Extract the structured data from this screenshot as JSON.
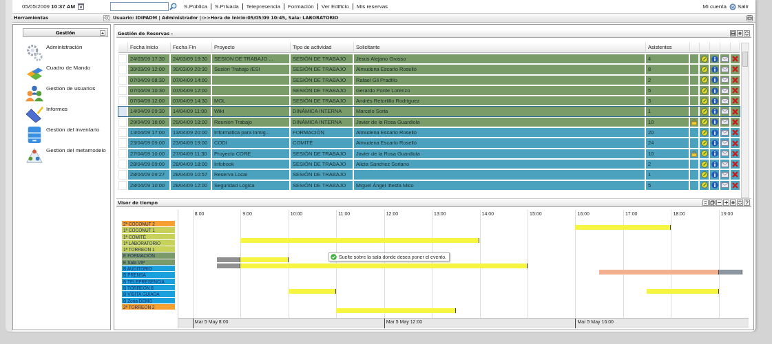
{
  "topbar": {
    "date": "05/05/2009 **10:37 AM**",
    "links": [
      "S.Pública",
      "S.Privada",
      "Telepresencia",
      "Formación",
      "Ver Edificio",
      "Mis reservas"
    ],
    "account": "Mi cuenta",
    "logout": "Salir"
  },
  "header": {
    "tools_title": "Herramientas",
    "session_info": "Usuario: IDIPADM | Administrador |:>>Hora de Inicio:05/05/09 10:45, Sala: LABORATORIO"
  },
  "sidebar": {
    "section": "Gestión",
    "expanded": true,
    "items": [
      "Administración",
      "Cuadro de Mando",
      "Gestión de usuarios",
      "Informes",
      "Gestión del inventario",
      "Gestión del metamodelo"
    ]
  },
  "reservations": {
    "title": "Gestión de Reservas -",
    "columns": [
      "Fecha Inicio",
      "Fecha Fin",
      "Proyecto",
      "Tipo de actividad",
      "Solicitante",
      "Asistentes"
    ],
    "rows": [
      {
        "start": "24/03/09 17:30",
        "end": "24/03/09 19:30",
        "project": "SESION DE TRABAJO ...",
        "activity": "SESIÓN DE TRABAJO",
        "requester": "Jesus Alejano Grosso",
        "attendees": "4",
        "color": "#7a9c69",
        "selected": false,
        "locked": false
      },
      {
        "start": "30/03/09 12:00",
        "end": "30/03/09 20:30",
        "project": "Sesión Trabajo /ESI",
        "activity": "SESIÓN DE TRABAJO",
        "requester": "Almudena Escario Roselló",
        "attendees": "8",
        "color": "#7a9c69",
        "selected": false,
        "locked": false
      },
      {
        "start": "07/04/09 08:30",
        "end": "07/04/09 14:00",
        "activity": "SESIÓN DE TRABAJO",
        "requester": "Rafael Gil Pradillo",
        "attendees": "2",
        "color": "#7a9c69",
        "selected": false,
        "locked": false
      },
      {
        "start": "07/04/09 10:30",
        "end": "07/04/09 12:00",
        "activity": "SESIÓN DE TRABAJO",
        "requester": "Gerardo Ponte Lorenzo",
        "attendees": "5",
        "color": "#7a9c69",
        "selected": false,
        "locked": false
      },
      {
        "start": "07/04/09 12:00",
        "end": "07/04/09 14:30",
        "project": "MOL",
        "activity": "SESIÓN DE TRABAJO",
        "requester": "Andrés Retortillo Rodríguez",
        "attendees": "3",
        "color": "#7a9c69",
        "selected": false,
        "locked": false
      },
      {
        "start": "14/04/09 09:30",
        "end": "14/04/09 11:00",
        "project": "Wiki",
        "activity": "DINÁMICA INTERNA",
        "requester": "Marcelo Soria",
        "attendees": "1",
        "color": "#7a9c69",
        "selected": true,
        "locked": false
      },
      {
        "start": "29/04/09 16:00",
        "end": "29/04/09 18:00",
        "project": "Reunión Trabajo",
        "activity": "DINÁMICA INTERNA",
        "requester": "Javier de la Rosa Guardiola",
        "attendees": "10",
        "color": "#7a9c69",
        "selected": false,
        "locked": true
      },
      {
        "start": "13/04/09 17:00",
        "end": "13/04/09 20:00",
        "project": "Informatica para Inmig...",
        "activity": "FORMACIÓN",
        "requester": "Almudena Escario Roselló",
        "attendees": "20",
        "color": "#4aa2bf",
        "selected": false,
        "locked": false
      },
      {
        "start": "23/04/09 09:00",
        "end": "23/04/09 19:00",
        "project": "CODI",
        "activity": "COMITÉ",
        "requester": "Almudena Escario Roselló",
        "attendees": "24",
        "color": "#4aa2bf",
        "selected": false,
        "locked": false
      },
      {
        "start": "27/04/09 10:00",
        "end": "27/04/09 11:30",
        "project": "Proyecto CORE",
        "activity": "SESIÓN DE TRABAJO",
        "requester": "Javier de la Rosa Guardiola",
        "attendees": "10",
        "color": "#4aa2bf",
        "selected": false,
        "locked": true
      },
      {
        "start": "28/04/09 09:00",
        "end": "28/04/09 18:00",
        "project": "Infobook",
        "activity": "SESIÓN DE TRABAJO",
        "requester": "Alicia Sanchez Soriano",
        "attendees": "2",
        "color": "#4aa2bf",
        "selected": false,
        "locked": false
      },
      {
        "start": "28/04/09 09:27",
        "end": "28/04/09 10:57",
        "project": "Reserva Local",
        "activity": "SESIÓN DE TRABAJO",
        "attendees": "1",
        "color": "#4aa2bf",
        "selected": false,
        "locked": false
      },
      {
        "start": "28/04/09 10:00",
        "end": "28/04/09 12:00",
        "project": "Seguridad Lógica",
        "activity": "SESIÓN DE TRABAJO",
        "requester": "Miguel Ángel Iñesta Mico",
        "attendees": "5",
        "color": "#4aa2bf",
        "selected": false,
        "locked": false
      }
    ]
  },
  "timeline": {
    "title": "Visor de tiempo",
    "rooms": [
      {
        "name": "2ª COCONUT 2",
        "color": "#f5a031",
        "slots": [
          {
            "booked": false
          },
          {
            "booked": false
          },
          {
            "booked": false
          },
          {
            "booked": false
          },
          {
            "booked": false
          },
          {
            "booked": false
          },
          {
            "booked": false
          },
          {
            "booked": false
          },
          {
            "booked": false
          },
          {
            "booked": false
          },
          {
            "booked": false
          },
          {
            "booked": false
          },
          {
            "booked": false
          },
          {
            "booked": false
          },
          {
            "booked": false
          },
          {
            "booked": false
          },
          {
            "booked": true,
            "color": "#f5f542"
          },
          {
            "booked": true,
            "color": "#f5f542"
          },
          {
            "booked": true,
            "color": "#f5f542"
          },
          {
            "booked": true,
            "color": "#f5f542"
          },
          {
            "booked": false
          },
          {
            "booked": false
          },
          {
            "booked": false
          }
        ]
      },
      {
        "name": "1ª COCONUT 1",
        "color": "#c8d25a"
      },
      {
        "name": "1ª COMITÉ",
        "color": "#c8d25a",
        "slots": [
          {
            "booked": false
          },
          {
            "booked": false
          },
          {
            "booked": true,
            "color": "#f5f542"
          },
          {
            "booked": true,
            "color": "#f5f542"
          },
          {
            "booked": true,
            "color": "#f5f542"
          },
          {
            "booked": true,
            "color": "#f5f542"
          },
          {
            "booked": true,
            "color": "#f5f542"
          },
          {
            "booked": true,
            "color": "#f5f542"
          },
          {
            "booked": true,
            "color": "#f5f542"
          },
          {
            "booked": true,
            "color": "#f5f542"
          },
          {
            "booked": true,
            "color": "#f5f542"
          },
          {
            "booked": true,
            "color": "#f5f542"
          },
          {
            "booked": false
          },
          {
            "booked": false
          },
          {
            "booked": false
          },
          {
            "booked": false
          },
          {
            "booked": false
          },
          {
            "booked": false
          },
          {
            "booked": false
          },
          {
            "booked": false
          },
          {
            "booked": false
          },
          {
            "booked": false
          },
          {
            "booked": false
          }
        ]
      },
      {
        "name": "1ª LABORATORIO",
        "color": "#c8d25a"
      },
      {
        "name": "1ª TORREON 1",
        "color": "#c8d25a"
      },
      {
        "name": "E FORMACIÓN",
        "color": "#7a9a6a",
        "slots": [
          {
            "booked": false
          },
          {
            "booked": true,
            "color": "#909090"
          },
          {
            "booked": true,
            "color": "#f5f542"
          },
          {
            "booked": true,
            "color": "#f5f542"
          },
          {
            "booked": false
          },
          {
            "booked": false
          },
          {
            "booked": false
          },
          {
            "booked": false
          },
          {
            "booked": false
          },
          {
            "booked": false
          },
          {
            "booked": false
          },
          {
            "booked": false
          },
          {
            "booked": false
          },
          {
            "booked": false
          },
          {
            "booked": false
          },
          {
            "booked": false
          },
          {
            "booked": false
          },
          {
            "booked": false
          },
          {
            "booked": false
          },
          {
            "booked": false
          },
          {
            "booked": false
          },
          {
            "booked": false
          },
          {
            "booked": false
          }
        ]
      },
      {
        "name": "E Sala VIP",
        "color": "#7a9a6a",
        "slots": [
          {
            "booked": false
          },
          {
            "booked": true,
            "color": "#909090"
          },
          {
            "booked": true,
            "color": "#f5f542"
          },
          {
            "booked": true,
            "color": "#f5f542"
          },
          {
            "booked": true,
            "color": "#f5f542"
          },
          {
            "booked": true,
            "color": "#f5f542"
          },
          {
            "booked": true,
            "color": "#f5f542"
          },
          {
            "booked": true,
            "color": "#f5f542"
          },
          {
            "booked": true,
            "color": "#f5f542"
          },
          {
            "booked": true,
            "color": "#f5f542"
          },
          {
            "booked": true,
            "color": "#f5f542"
          },
          {
            "booked": true,
            "color": "#f5f542"
          },
          {
            "booked": true,
            "color": "#f5f542"
          },
          {
            "booked": true,
            "color": "#f5f542"
          },
          {
            "booked": false
          },
          {
            "booked": false
          },
          {
            "booked": false
          },
          {
            "booked": false
          },
          {
            "booked": false
          },
          {
            "booked": false
          },
          {
            "booked": false
          },
          {
            "booked": false
          },
          {
            "booked": false
          }
        ]
      },
      {
        "name": "B AUDITORIO",
        "color": "#1aa0dc",
        "slots": [
          {
            "booked": false
          },
          {
            "booked": false
          },
          {
            "booked": false
          },
          {
            "booked": false
          },
          {
            "booked": false
          },
          {
            "booked": false
          },
          {
            "booked": false
          },
          {
            "booked": false
          },
          {
            "booked": false
          },
          {
            "booked": false
          },
          {
            "booked": false
          },
          {
            "booked": false
          },
          {
            "booked": false
          },
          {
            "booked": false
          },
          {
            "booked": false
          },
          {
            "booked": false
          },
          {
            "booked": false
          },
          {
            "booked": true,
            "color": "#f2b08f"
          },
          {
            "booked": true,
            "color": "#f2b08f"
          },
          {
            "booked": true,
            "color": "#f2b08f"
          },
          {
            "booked": true,
            "color": "#f2b08f"
          },
          {
            "booked": true,
            "color": "#f2b08f"
          },
          {
            "booked": true,
            "color": "#8c96a0"
          }
        ]
      },
      {
        "name": "B PRENSA",
        "color": "#1aa0dc"
      },
      {
        "name": "B TELEPRESENCIA",
        "color": "#1aa0dc"
      },
      {
        "name": "B TORREON 8",
        "color": "#1aa0dc",
        "slots": [
          {
            "booked": false
          },
          {
            "booked": false
          },
          {
            "booked": false
          },
          {
            "booked": false
          },
          {
            "booked": true,
            "color": "#f5f542"
          },
          {
            "booked": true,
            "color": "#f5f542"
          },
          {
            "booked": false
          },
          {
            "booked": false
          },
          {
            "booked": false
          },
          {
            "booked": false
          },
          {
            "booked": false
          },
          {
            "booked": false
          },
          {
            "booked": false
          },
          {
            "booked": false
          },
          {
            "booked": false
          },
          {
            "booked": false
          },
          {
            "booked": false
          },
          {
            "booked": false
          },
          {
            "booked": false
          },
          {
            "booked": true,
            "color": "#f5f542"
          },
          {
            "booked": true,
            "color": "#f5f542"
          },
          {
            "booked": true,
            "color": "#f5f542"
          },
          {
            "booked": false
          }
        ]
      },
      {
        "name": "B VISITA GUIADA",
        "color": "#1aa0dc"
      },
      {
        "name": "B Zona DEMO",
        "color": "#1aa0dc"
      },
      {
        "name": "2ª TORREON 2",
        "color": "#f5a031",
        "slots": [
          {
            "booked": false
          },
          {
            "booked": false
          },
          {
            "booked": false
          },
          {
            "booked": false
          },
          {
            "booked": false
          },
          {
            "booked": false
          },
          {
            "booked": true,
            "color": "#f5f542"
          },
          {
            "booked": true,
            "color": "#f5f542"
          },
          {
            "booked": true,
            "color": "#f5f542"
          },
          {
            "booked": true,
            "color": "#f5f542"
          },
          {
            "booked": true,
            "color": "#f5f542"
          },
          {
            "booked": false
          },
          {
            "booked": false
          },
          {
            "booked": false
          },
          {
            "booked": false
          },
          {
            "booked": false
          },
          {
            "booked": false
          },
          {
            "booked": false
          },
          {
            "booked": false
          },
          {
            "booked": false
          },
          {
            "booked": false
          },
          {
            "booked": false
          },
          {
            "booked": false
          }
        ]
      }
    ],
    "hours": [
      "8:00",
      "9:00",
      "10:00",
      "11:00",
      "12:00",
      "13:00",
      "14:00",
      "15:00",
      "16:00",
      "17:00",
      "18:00",
      "19:00"
    ],
    "tooltip": "Suelte sobre la sala donde desea poner el evento.",
    "axis_labels": [
      "Mar 5 May 8:00",
      "Mar 5 May 12:00",
      "Mar 5 May 16:00"
    ]
  }
}
